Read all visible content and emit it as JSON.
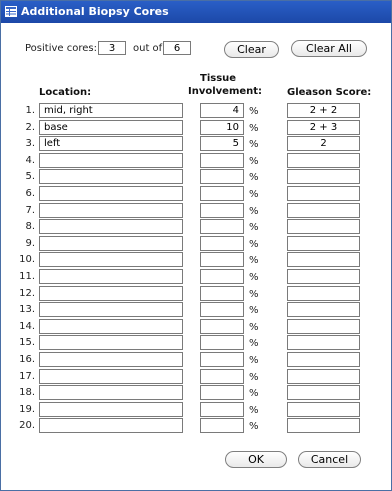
{
  "window": {
    "title": "Additional Biopsy Cores",
    "icon": "table-icon"
  },
  "positive": {
    "label": "Positive cores:",
    "value": "3",
    "out_of_label": "out of",
    "total": "6"
  },
  "buttons": {
    "clear": "Clear",
    "clear_all": "Clear All",
    "ok": "OK",
    "cancel": "Cancel"
  },
  "columns": {
    "location": "Location:",
    "tissue_line1": "Tissue",
    "tissue_line2": "Involvement:",
    "gleason": "Gleason Score:"
  },
  "percent_symbol": "%",
  "rows": [
    {
      "num": "1.",
      "location": "mid, right",
      "tissue": "4",
      "gleason": "2 + 2"
    },
    {
      "num": "2.",
      "location": "base",
      "tissue": "10",
      "gleason": "2 + 3"
    },
    {
      "num": "3.",
      "location": "left",
      "tissue": "5",
      "gleason": "2"
    },
    {
      "num": "4.",
      "location": "",
      "tissue": "",
      "gleason": ""
    },
    {
      "num": "5.",
      "location": "",
      "tissue": "",
      "gleason": ""
    },
    {
      "num": "6.",
      "location": "",
      "tissue": "",
      "gleason": ""
    },
    {
      "num": "7.",
      "location": "",
      "tissue": "",
      "gleason": ""
    },
    {
      "num": "8.",
      "location": "",
      "tissue": "",
      "gleason": ""
    },
    {
      "num": "9.",
      "location": "",
      "tissue": "",
      "gleason": ""
    },
    {
      "num": "10.",
      "location": "",
      "tissue": "",
      "gleason": ""
    },
    {
      "num": "11.",
      "location": "",
      "tissue": "",
      "gleason": ""
    },
    {
      "num": "12.",
      "location": "",
      "tissue": "",
      "gleason": ""
    },
    {
      "num": "13.",
      "location": "",
      "tissue": "",
      "gleason": ""
    },
    {
      "num": "14.",
      "location": "",
      "tissue": "",
      "gleason": ""
    },
    {
      "num": "15.",
      "location": "",
      "tissue": "",
      "gleason": ""
    },
    {
      "num": "16.",
      "location": "",
      "tissue": "",
      "gleason": ""
    },
    {
      "num": "17.",
      "location": "",
      "tissue": "",
      "gleason": ""
    },
    {
      "num": "18.",
      "location": "",
      "tissue": "",
      "gleason": ""
    },
    {
      "num": "19.",
      "location": "",
      "tissue": "",
      "gleason": ""
    },
    {
      "num": "20.",
      "location": "",
      "tissue": "",
      "gleason": ""
    }
  ]
}
